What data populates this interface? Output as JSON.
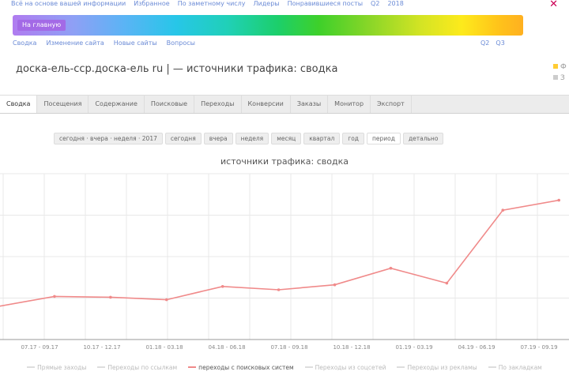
{
  "top_links": [
    "Всё на основе вашей информации",
    "Избранное",
    "По заметному числу",
    "Лидеры",
    "Понравившиеся посты",
    "Q2",
    "2018"
  ],
  "rainbow_badge": "На главную",
  "sub_links": [
    "Сводка",
    "Изменение сайта",
    "Новые сайты",
    "Вопросы"
  ],
  "sub_links_right": [
    "Q2",
    "Q3"
  ],
  "page_title": "доска-ель-сcp.доска-ель ru | — источники трафика: сводка",
  "side_legend": [
    "Ф",
    "З"
  ],
  "tabs": [
    {
      "label": "Сводка",
      "active": true
    },
    {
      "label": "Посещения"
    },
    {
      "label": "Содержание"
    },
    {
      "label": "Поисковые"
    },
    {
      "label": "Переходы"
    },
    {
      "label": "Конверсии"
    },
    {
      "label": "Заказы"
    },
    {
      "label": "Монитор"
    },
    {
      "label": "Экспорт"
    }
  ],
  "periods": [
    {
      "label": "сегодня · вчера · неделя · 2017"
    },
    {
      "label": "сегодня"
    },
    {
      "label": "вчера"
    },
    {
      "label": "неделя"
    },
    {
      "label": "месяц"
    },
    {
      "label": "квартал"
    },
    {
      "label": "год"
    },
    {
      "label": "период",
      "active": true
    },
    {
      "label": "детально"
    }
  ],
  "colors": {
    "accent": "#f08a8a",
    "grid": "#e8e8e8",
    "axis": "#999999"
  },
  "chart_data": {
    "type": "line",
    "title": "источники трафика: сводка",
    "xlabel": "",
    "ylabel": "",
    "categories": [
      "07.17 - 09.17",
      "10.17 - 12.17",
      "01.18 - 03.18",
      "04.18 - 06.18",
      "07.18 - 09.18",
      "10.18 - 12.18",
      "01.19 - 03.19",
      "04.19 - 06.19",
      "07.19 - 09.19",
      "10.19 - 12.19"
    ],
    "series": [
      {
        "name": "переходы с поисковых систем",
        "values": [
          40,
          52,
          51,
          48,
          64,
          60,
          66,
          86,
          68,
          156,
          168
        ]
      }
    ],
    "x_points": 11,
    "ylim": [
      0,
      200
    ],
    "grid": true,
    "legend_position": "bottom"
  },
  "legend": [
    {
      "label": "Прямые заходы"
    },
    {
      "label": "Переходы по ссылкам"
    },
    {
      "label": "переходы с поисковых систем",
      "active": true
    },
    {
      "label": "Переходы из соцсетей"
    },
    {
      "label": "Переходы из рекламы"
    },
    {
      "label": "По закладкам"
    }
  ]
}
